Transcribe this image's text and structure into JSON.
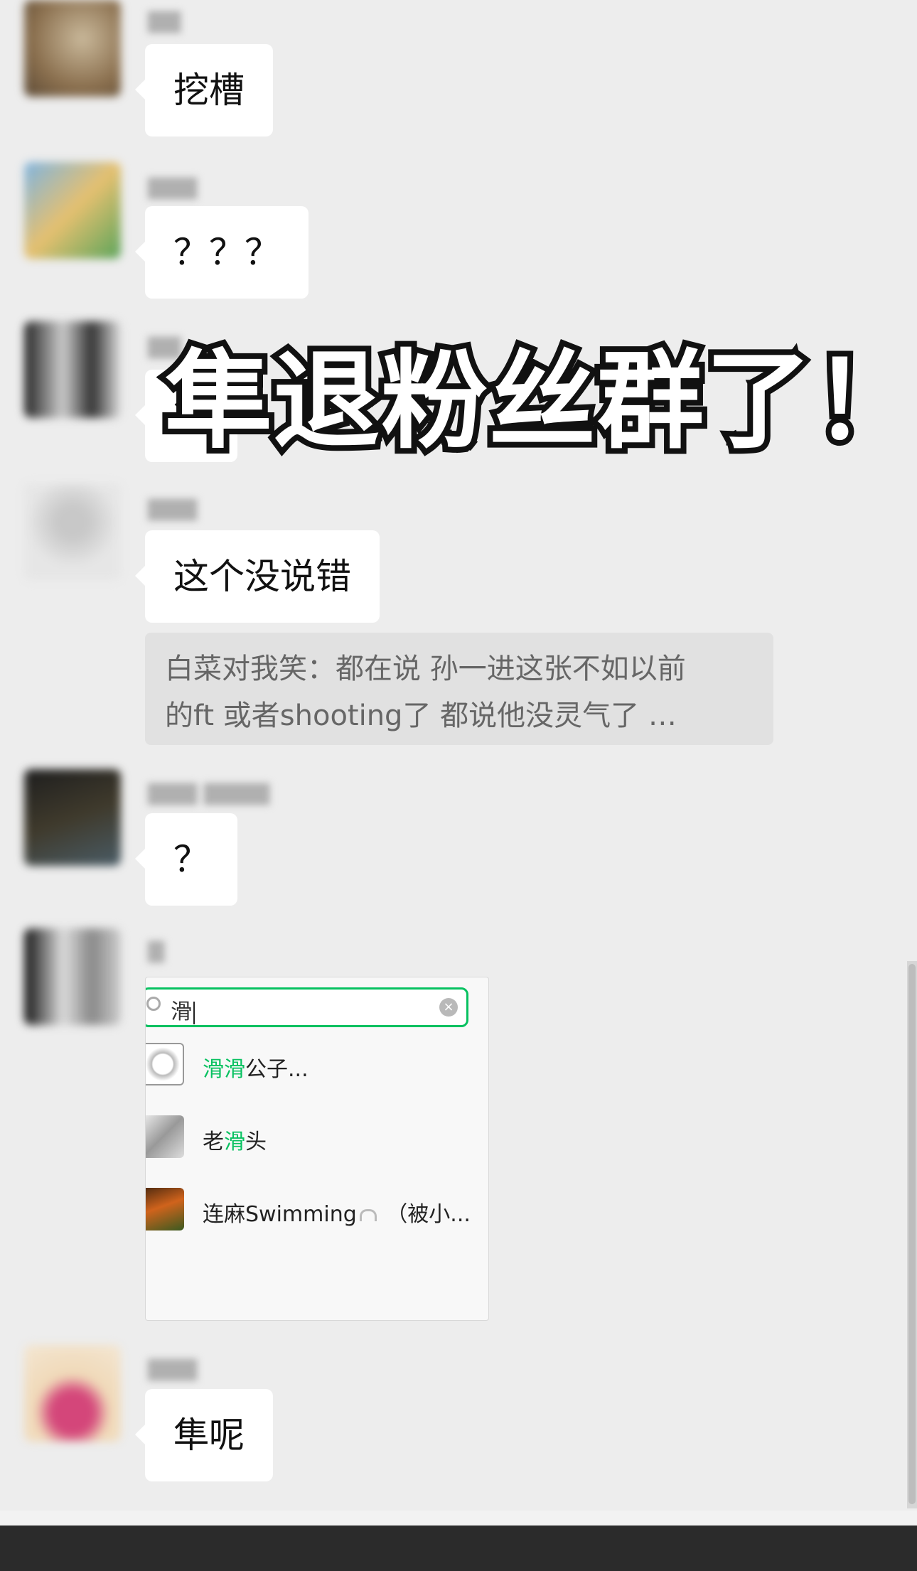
{
  "overlay": {
    "headline": "隼退粉丝群了！"
  },
  "messages": [
    {
      "bubble": "挖槽"
    },
    {
      "bubble": "？？？"
    },
    {
      "bubble": "？"
    },
    {
      "bubble": "这个没说错"
    },
    {
      "bubble": "？"
    },
    {
      "bubble": "隼呢"
    }
  ],
  "quote": {
    "line1": "白菜对我笑：都在说 孙一进这张不如以前",
    "line2": "的ft 或者shooting了 都说他没灵气了 …"
  },
  "mention_panel": {
    "search_value": "滑",
    "items": [
      {
        "highlight": "滑滑",
        "rest": "公子..."
      },
      {
        "prefix": "老",
        "highlight": "滑",
        "rest": "头"
      },
      {
        "prefix": "连麻Swimming",
        "rest": " （被小..."
      }
    ]
  },
  "colors": {
    "background": "#ededed",
    "bubble": "#ffffff",
    "accent_green": "#07c160",
    "bottom_bar": "#2b2b2b"
  },
  "icons": {
    "search": "search-icon",
    "clear": "clear-icon",
    "headphones": "headphones-icon"
  }
}
